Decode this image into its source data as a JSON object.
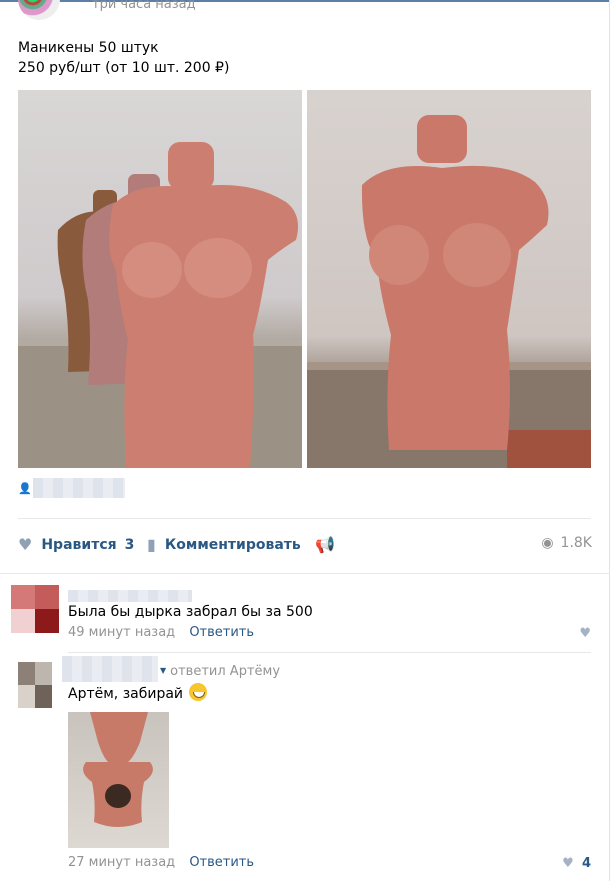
{
  "post": {
    "time": "три часа назад",
    "text_line1": "Маникены 50 штук",
    "text_line2": "250 руб/шт (от 10 шт. 200 ₽)"
  },
  "actions": {
    "like_label": "Нравится",
    "like_count": "3",
    "comment_label": "Комментировать",
    "views": "1.8K"
  },
  "comments": [
    {
      "text": "Была бы дырка забрал бы за 500",
      "time": "49 минут назад",
      "reply_label": "Ответить",
      "likes": ""
    },
    {
      "replied_to": "ответил Артёму",
      "text": "Артём, забирай",
      "time": "27 минут назад",
      "reply_label": "Ответить",
      "likes": "4"
    }
  ],
  "icons": {
    "like": "heart-icon",
    "comment": "comment-icon",
    "share": "megaphone-icon",
    "views": "eye-icon",
    "author": "person-icon"
  },
  "colors": {
    "link": "#2a5885",
    "meta": "#939393",
    "icon": "#8fa1b4",
    "mannequin": "#c97c6f"
  }
}
